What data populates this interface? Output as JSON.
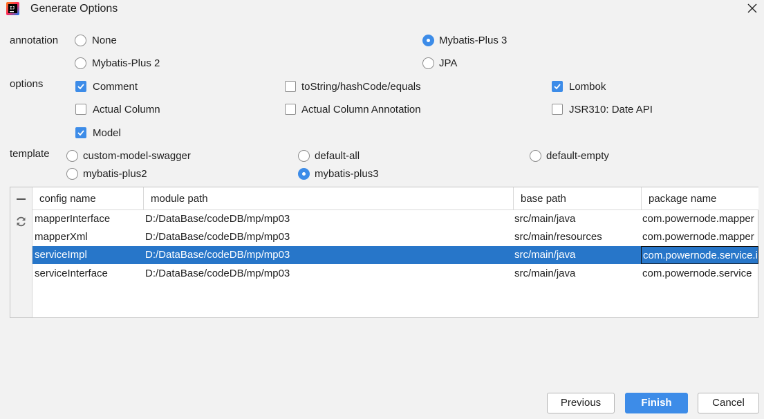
{
  "window": {
    "title": "Generate Options",
    "app_icon": "intellij-idea-icon",
    "close_icon": "close-icon"
  },
  "annotation": {
    "label": "annotation",
    "options": [
      {
        "label": "None",
        "selected": false
      },
      {
        "label": "Mybatis-Plus 3",
        "selected": true
      },
      {
        "label": "Mybatis-Plus 2",
        "selected": false
      },
      {
        "label": "JPA",
        "selected": false
      }
    ]
  },
  "options": {
    "label": "options",
    "items": [
      {
        "label": "Comment",
        "checked": true
      },
      {
        "label": "toString/hashCode/equals",
        "checked": false
      },
      {
        "label": "Lombok",
        "checked": true
      },
      {
        "label": "Actual Column",
        "checked": false
      },
      {
        "label": "Actual Column Annotation",
        "checked": false
      },
      {
        "label": "JSR310: Date API",
        "checked": false
      },
      {
        "label": "Model",
        "checked": true
      }
    ]
  },
  "template": {
    "label": "template",
    "options": [
      {
        "label": "custom-model-swagger",
        "selected": false
      },
      {
        "label": "default-all",
        "selected": false
      },
      {
        "label": "default-empty",
        "selected": false
      },
      {
        "label": "mybatis-plus2",
        "selected": false
      },
      {
        "label": "mybatis-plus3",
        "selected": true
      }
    ]
  },
  "table": {
    "toolbar": {
      "remove_icon": "minus-icon",
      "refresh_icon": "refresh-icon"
    },
    "columns": [
      "config name",
      "module path",
      "base path",
      "package name"
    ],
    "rows": [
      [
        "mapperInterface",
        "D:/DataBase/codeDB/mp/mp03",
        "src/main/java",
        "com.powernode.mapper"
      ],
      [
        "mapperXml",
        "D:/DataBase/codeDB/mp/mp03",
        "src/main/resources",
        "com.powernode.mapper"
      ],
      [
        "serviceImpl",
        "D:/DataBase/codeDB/mp/mp03",
        "src/main/java",
        "com.powernode.service.impl"
      ],
      [
        "serviceInterface",
        "D:/DataBase/codeDB/mp/mp03",
        "src/main/java",
        "com.powernode.service"
      ]
    ],
    "selected_row": 2
  },
  "buttons": {
    "previous": "Previous",
    "finish": "Finish",
    "cancel": "Cancel"
  },
  "colors": {
    "accent": "#3d8ce8",
    "selection": "#2776c9",
    "background": "#f2f2f2"
  }
}
